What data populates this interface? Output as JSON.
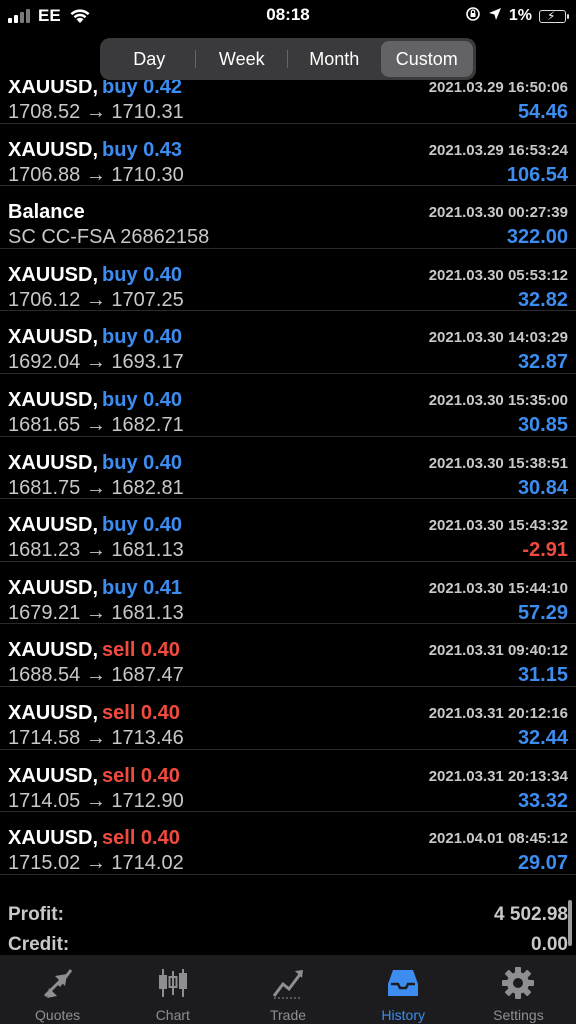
{
  "status_bar": {
    "carrier": "EE",
    "time": "08:18",
    "battery": "1%"
  },
  "period_tabs": [
    {
      "label": "Day",
      "active": false
    },
    {
      "label": "Week",
      "active": false
    },
    {
      "label": "Month",
      "active": false
    },
    {
      "label": "Custom",
      "active": true
    }
  ],
  "history": [
    {
      "symbol": "XAUUSD,",
      "side": "buy",
      "lots": "buy 0.42",
      "prices": "1708.52 → 1710.31",
      "datetime": "2021.03.29 16:50:06",
      "profit": "54.46"
    },
    {
      "symbol": "XAUUSD,",
      "side": "buy",
      "lots": "buy 0.43",
      "prices": "1706.88 → 1710.30",
      "datetime": "2021.03.29 16:53:24",
      "profit": "106.54"
    },
    {
      "symbol": "Balance",
      "side": "",
      "lots": "",
      "prices": "SC CC-FSA 26862158",
      "datetime": "2021.03.30 00:27:39",
      "profit": "322.00"
    },
    {
      "symbol": "XAUUSD,",
      "side": "buy",
      "lots": "buy 0.40",
      "prices": "1706.12 → 1707.25",
      "datetime": "2021.03.30 05:53:12",
      "profit": "32.82"
    },
    {
      "symbol": "XAUUSD,",
      "side": "buy",
      "lots": "buy 0.40",
      "prices": "1692.04 → 1693.17",
      "datetime": "2021.03.30 14:03:29",
      "profit": "32.87"
    },
    {
      "symbol": "XAUUSD,",
      "side": "buy",
      "lots": "buy 0.40",
      "prices": "1681.65 → 1682.71",
      "datetime": "2021.03.30 15:35:00",
      "profit": "30.85"
    },
    {
      "symbol": "XAUUSD,",
      "side": "buy",
      "lots": "buy 0.40",
      "prices": "1681.75 → 1682.81",
      "datetime": "2021.03.30 15:38:51",
      "profit": "30.84"
    },
    {
      "symbol": "XAUUSD,",
      "side": "buy",
      "lots": "buy 0.40",
      "prices": "1681.23 → 1681.13",
      "datetime": "2021.03.30 15:43:32",
      "profit": "-2.91"
    },
    {
      "symbol": "XAUUSD,",
      "side": "buy",
      "lots": "buy 0.41",
      "prices": "1679.21 → 1681.13",
      "datetime": "2021.03.30 15:44:10",
      "profit": "57.29"
    },
    {
      "symbol": "XAUUSD,",
      "side": "sell",
      "lots": "sell 0.40",
      "prices": "1688.54 → 1687.47",
      "datetime": "2021.03.31 09:40:12",
      "profit": "31.15"
    },
    {
      "symbol": "XAUUSD,",
      "side": "sell",
      "lots": "sell 0.40",
      "prices": "1714.58 → 1713.46",
      "datetime": "2021.03.31 20:12:16",
      "profit": "32.44"
    },
    {
      "symbol": "XAUUSD,",
      "side": "sell",
      "lots": "sell 0.40",
      "prices": "1714.05 → 1712.90",
      "datetime": "2021.03.31 20:13:34",
      "profit": "33.32"
    },
    {
      "symbol": "XAUUSD,",
      "side": "sell",
      "lots": "sell 0.40",
      "prices": "1715.02 → 1714.02",
      "datetime": "2021.04.01 08:45:12",
      "profit": "29.07"
    }
  ],
  "summary": {
    "profit_label": "Profit:",
    "profit_value": "4 502.98",
    "credit_label": "Credit:",
    "credit_value": "0.00"
  },
  "tab_bar": [
    {
      "label": "Quotes",
      "icon": "quotes-arrows-icon",
      "active": false
    },
    {
      "label": "Chart",
      "icon": "candlestick-chart-icon",
      "active": false
    },
    {
      "label": "Trade",
      "icon": "trend-line-icon",
      "active": false
    },
    {
      "label": "History",
      "icon": "inbox-tray-icon",
      "active": true
    },
    {
      "label": "Settings",
      "icon": "gear-icon",
      "active": false
    }
  ],
  "colors": {
    "buy": "#3d8cf0",
    "sell": "#f14a3e",
    "background": "#000000",
    "accent": "#3d8cf0"
  }
}
